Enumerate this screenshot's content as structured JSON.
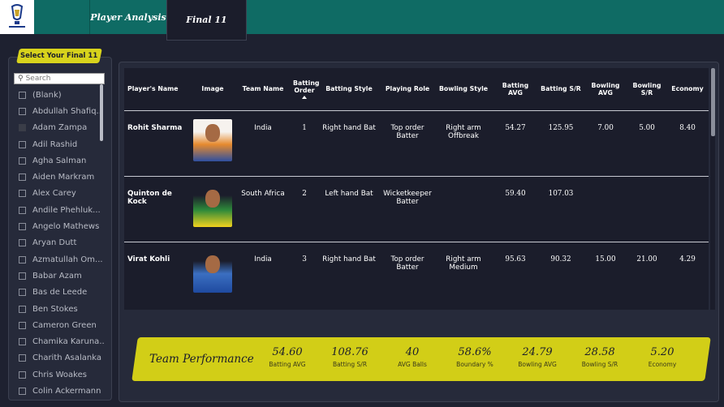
{
  "tabs": {
    "analysis": "Player Analysis",
    "final": "Final 11"
  },
  "selector": {
    "title": "Select Your Final 11",
    "search_placeholder": "Search",
    "items": [
      {
        "label": "(Blank)",
        "checked": false
      },
      {
        "label": "Abdullah Shafiq...",
        "checked": false
      },
      {
        "label": "Adam Zampa",
        "checked": true
      },
      {
        "label": "Adil Rashid",
        "checked": false
      },
      {
        "label": "Agha Salman",
        "checked": false
      },
      {
        "label": "Aiden Markram",
        "checked": false
      },
      {
        "label": "Alex Carey",
        "checked": false
      },
      {
        "label": "Andile Phehluk...",
        "checked": false
      },
      {
        "label": "Angelo Mathews",
        "checked": false
      },
      {
        "label": "Aryan Dutt",
        "checked": false
      },
      {
        "label": "Azmatullah Om...",
        "checked": false
      },
      {
        "label": "Babar Azam",
        "checked": false
      },
      {
        "label": "Bas de Leede",
        "checked": false
      },
      {
        "label": "Ben Stokes",
        "checked": false
      },
      {
        "label": "Cameron Green",
        "checked": false
      },
      {
        "label": "Chamika Karuna...",
        "checked": false
      },
      {
        "label": "Charith Asalanka",
        "checked": false
      },
      {
        "label": "Chris Woakes",
        "checked": false
      },
      {
        "label": "Colin Ackermann",
        "checked": false
      }
    ]
  },
  "table": {
    "headers": {
      "name": "Player's Name",
      "image": "Image",
      "team": "Team Name",
      "order": "Batting Order",
      "bat_style": "Batting Style",
      "role": "Playing Role",
      "bowl_style": "Bowling Style",
      "bat_avg": "Batting AVG",
      "bat_sr": "Batting S/R",
      "bowl_avg": "Bowling AVG",
      "bowl_sr": "Bowling S/R",
      "economy": "Economy"
    },
    "rows": [
      {
        "name": "Rohit Sharma",
        "team": "India",
        "order": "1",
        "bat_style": "Right hand Bat",
        "role": "Top order Batter",
        "bowl_style": "Right arm Offbreak",
        "bat_avg": "54.27",
        "bat_sr": "125.95",
        "bowl_avg": "7.00",
        "bowl_sr": "5.00",
        "economy": "8.40"
      },
      {
        "name": "Quinton de Kock",
        "team": "South Africa",
        "order": "2",
        "bat_style": "Left hand Bat",
        "role": "Wicketkeeper Batter",
        "bowl_style": "",
        "bat_avg": "59.40",
        "bat_sr": "107.03",
        "bowl_avg": "",
        "bowl_sr": "",
        "economy": ""
      },
      {
        "name": "Virat Kohli",
        "team": "India",
        "order": "3",
        "bat_style": "Right hand Bat",
        "role": "Top order Batter",
        "bowl_style": "Right arm Medium",
        "bat_avg": "95.63",
        "bat_sr": "90.32",
        "bowl_avg": "15.00",
        "bowl_sr": "21.00",
        "economy": "4.29"
      }
    ]
  },
  "team_performance": {
    "title": "Team Performance",
    "kpis": [
      {
        "value": "54.60",
        "label": "Batting AVG"
      },
      {
        "value": "108.76",
        "label": "Batting S/R"
      },
      {
        "value": "40",
        "label": "AVG Balls"
      },
      {
        "value": "58.6%",
        "label": "Boundary %"
      },
      {
        "value": "24.79",
        "label": "Bowling AVG"
      },
      {
        "value": "28.58",
        "label": "Bowling S/R"
      },
      {
        "value": "5.20",
        "label": "Economy"
      }
    ]
  },
  "colors": {
    "teal": "#0f6b64",
    "accent": "#d2ce17",
    "panel": "#262a3a",
    "table_bg": "#1b1d2b"
  }
}
